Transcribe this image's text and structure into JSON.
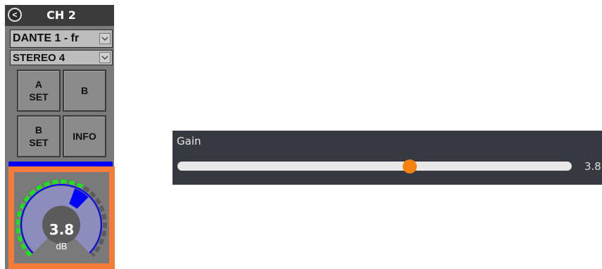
{
  "channel": {
    "title": "CH 2",
    "back_icon": "<",
    "input_select": "DANTE 1 - fr",
    "output_select": "STEREO 4"
  },
  "buttons": {
    "a_set": "A\nSET",
    "b": "B",
    "b_set": "B\nSET",
    "info": "INFO"
  },
  "knob": {
    "value": "3.8",
    "unit": "dB",
    "level_fraction": 0.62
  },
  "gain": {
    "label": "Gain",
    "value": "3.8",
    "position_fraction": 0.59
  },
  "colors": {
    "accent_orange": "#f47b3a",
    "knob_green": "#22dd22",
    "knob_blue": "#0000ff",
    "thumb": "#f5820d"
  }
}
